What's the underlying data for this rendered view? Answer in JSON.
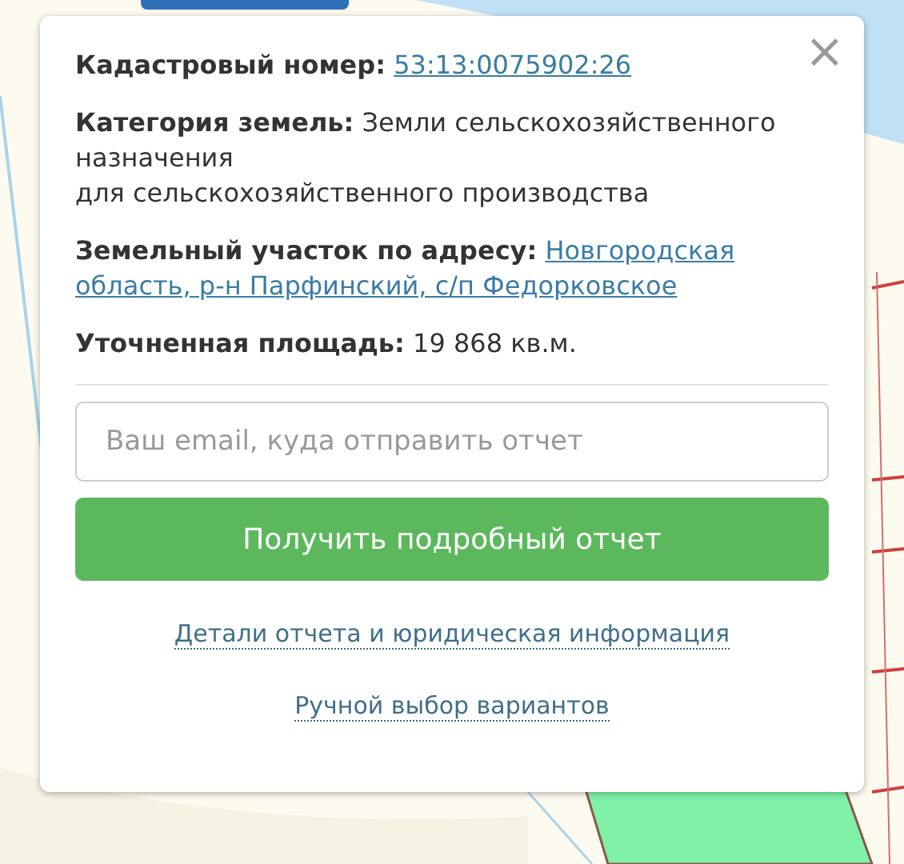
{
  "popup": {
    "close_label": "×",
    "fields": [
      {
        "label": "Кадастровый номер:",
        "value": "53:13:0075902:26",
        "kind": "link"
      },
      {
        "label": "Категория земель:",
        "value": "Земли сельскохозяйственного назначения",
        "extra": "для сельскохозяйственного производства",
        "kind": "text"
      },
      {
        "label": "Земельный участок по адресу:",
        "value_lines": [
          "Новгородская",
          "область, р-н Парфинский, с/п Федорковское"
        ],
        "kind": "link"
      },
      {
        "label": "Уточненная площадь:",
        "value": "19 868 кв.м.",
        "kind": "text"
      }
    ],
    "email_field": {
      "placeholder": "Ваш email, куда отправить отчет"
    },
    "submit_button": "Получить подробный отчет",
    "links": [
      "Детали отчета и юридическая информация",
      "Ручной выбор вариантов"
    ]
  }
}
